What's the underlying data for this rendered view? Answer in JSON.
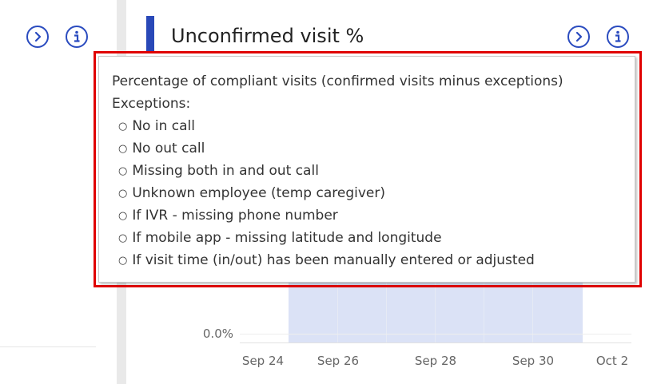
{
  "card": {
    "title": "Unconfirmed visit %",
    "accent_color": "#2948b8",
    "icons": [
      "chevron-right-circle-icon",
      "info-icon"
    ]
  },
  "left_panel": {
    "icons": [
      "chevron-right-circle-icon",
      "info-icon"
    ]
  },
  "tooltip": {
    "heading": "Percentage of compliant visits (confirmed visits minus exceptions)",
    "subheading": "Exceptions:",
    "items": [
      "No in call",
      "No out call",
      "Missing both in and out call",
      "Unknown employee (temp caregiver)",
      "If IVR - missing phone number",
      "If mobile app - missing latitude and longitude",
      "If visit time (in/out) has been manually entered or adjusted"
    ],
    "highlight_color": "#e00000"
  },
  "chart_data": {
    "type": "bar",
    "y_tick_labels": [
      "0.0%"
    ],
    "x_tick_labels": [
      "Sep 24",
      "Sep 26",
      "Sep 28",
      "Sep 30",
      "Oct 2"
    ],
    "highlight_color": "#dbe2f6"
  }
}
